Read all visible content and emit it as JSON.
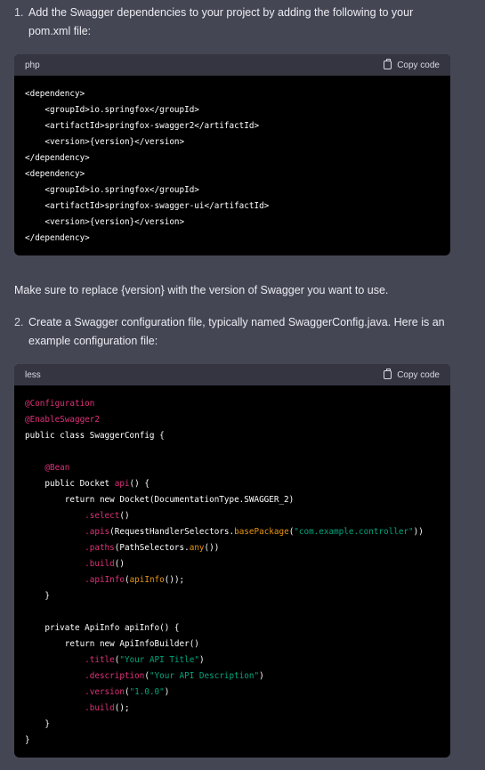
{
  "steps": [
    {
      "number": "1.",
      "text": "Add the Swagger dependencies to your project by adding the following to your pom.xml file:"
    },
    {
      "number": "2.",
      "text": "Create a Swagger configuration file, typically named SwaggerConfig.java. Here is an example configuration file:"
    }
  ],
  "note": "Make sure to replace {version} with the version of Swagger you want to use.",
  "code_blocks": [
    {
      "language": "php",
      "copy_label": "Copy code",
      "lines": [
        [
          {
            "t": "<dependency>"
          }
        ],
        [
          {
            "t": "    <groupId>io.springfox</groupId>"
          }
        ],
        [
          {
            "t": "    <artifactId>springfox-swagger2</artifactId>"
          }
        ],
        [
          {
            "t": "    <version>{version}</version>"
          }
        ],
        [
          {
            "t": "</dependency>"
          }
        ],
        [
          {
            "t": "<dependency>"
          }
        ],
        [
          {
            "t": "    <groupId>io.springfox</groupId>"
          }
        ],
        [
          {
            "t": "    <artifactId>springfox-swagger-ui</artifactId>"
          }
        ],
        [
          {
            "t": "    <version>{version}</version>"
          }
        ],
        [
          {
            "t": "</dependency>"
          }
        ]
      ]
    },
    {
      "language": "less",
      "copy_label": "Copy code",
      "lines": [
        [
          {
            "t": "@Configuration",
            "c": "pink"
          }
        ],
        [
          {
            "t": "@EnableSwagger2",
            "c": "pink"
          }
        ],
        [
          {
            "t": "public class SwaggerConfig {"
          }
        ],
        [
          {
            "t": ""
          }
        ],
        [
          {
            "t": "    "
          },
          {
            "t": "@Bean",
            "c": "pink"
          }
        ],
        [
          {
            "t": "    public Docket "
          },
          {
            "t": "api",
            "c": "pink"
          },
          {
            "t": "() {"
          }
        ],
        [
          {
            "t": "        return new Docket(DocumentationType.SWAGGER_2)"
          }
        ],
        [
          {
            "t": "            "
          },
          {
            "t": ".select",
            "c": "pink"
          },
          {
            "t": "()"
          }
        ],
        [
          {
            "t": "            "
          },
          {
            "t": ".apis",
            "c": "pink"
          },
          {
            "t": "(RequestHandlerSelectors."
          },
          {
            "t": "basePackage",
            "c": "orange"
          },
          {
            "t": "("
          },
          {
            "t": "\"com.example.controller\"",
            "c": "green"
          },
          {
            "t": "))"
          }
        ],
        [
          {
            "t": "            "
          },
          {
            "t": ".paths",
            "c": "pink"
          },
          {
            "t": "(PathSelectors."
          },
          {
            "t": "any",
            "c": "orange"
          },
          {
            "t": "())"
          }
        ],
        [
          {
            "t": "            "
          },
          {
            "t": ".build",
            "c": "pink"
          },
          {
            "t": "()"
          }
        ],
        [
          {
            "t": "            "
          },
          {
            "t": ".apiInfo",
            "c": "pink"
          },
          {
            "t": "("
          },
          {
            "t": "apiInfo",
            "c": "orange"
          },
          {
            "t": "());"
          }
        ],
        [
          {
            "t": "    }"
          }
        ],
        [
          {
            "t": ""
          }
        ],
        [
          {
            "t": "    private ApiInfo apiInfo() {"
          }
        ],
        [
          {
            "t": "        return new ApiInfoBuilder()"
          }
        ],
        [
          {
            "t": "            "
          },
          {
            "t": ".title",
            "c": "pink"
          },
          {
            "t": "("
          },
          {
            "t": "\"Your API Title\"",
            "c": "green"
          },
          {
            "t": ")"
          }
        ],
        [
          {
            "t": "            "
          },
          {
            "t": ".description",
            "c": "pink"
          },
          {
            "t": "("
          },
          {
            "t": "\"Your API Description\"",
            "c": "green"
          },
          {
            "t": ")"
          }
        ],
        [
          {
            "t": "            "
          },
          {
            "t": ".version",
            "c": "pink"
          },
          {
            "t": "("
          },
          {
            "t": "\"1.0.0\"",
            "c": "green"
          },
          {
            "t": ")"
          }
        ],
        [
          {
            "t": "            "
          },
          {
            "t": ".build",
            "c": "pink"
          },
          {
            "t": "();"
          }
        ],
        [
          {
            "t": "    }"
          }
        ],
        [
          {
            "t": "}"
          }
        ]
      ]
    }
  ]
}
